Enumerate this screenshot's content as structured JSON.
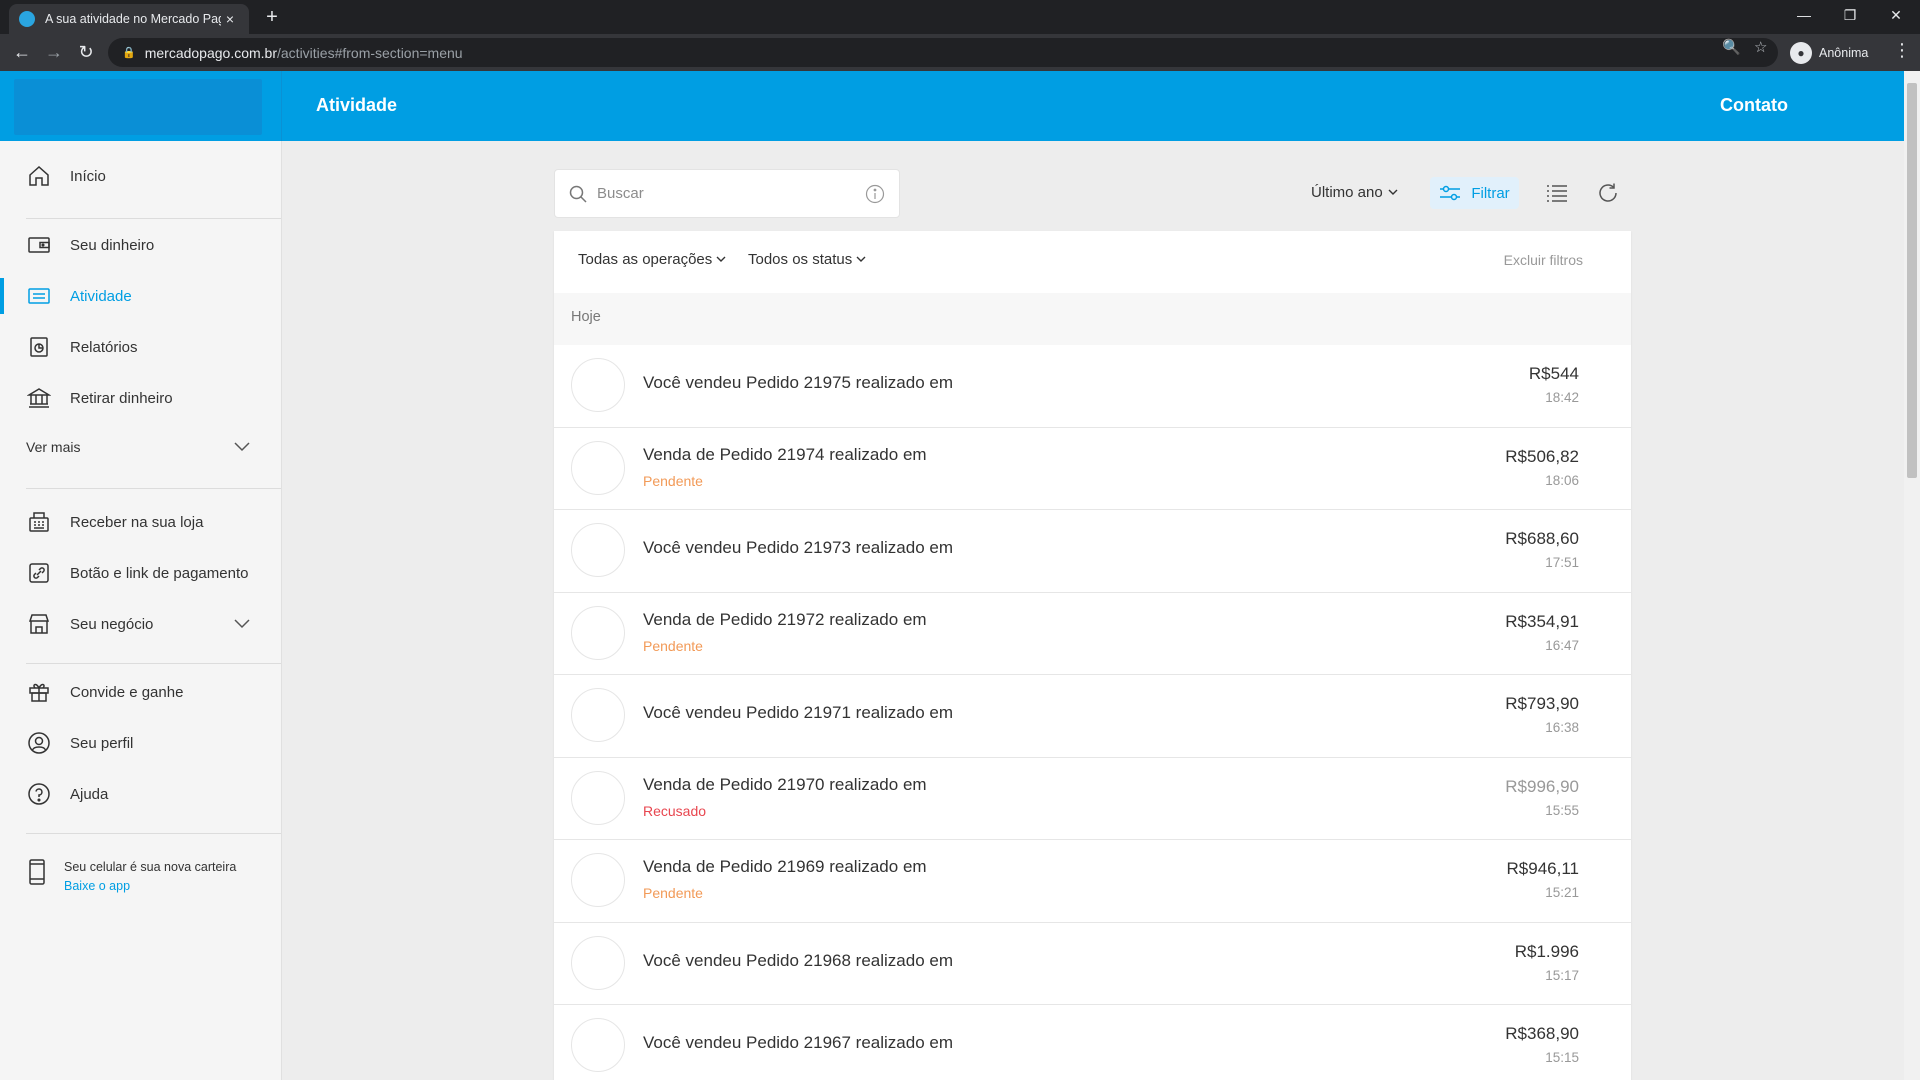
{
  "browser": {
    "tab_title": "A sua atividade no Mercado Pago",
    "tab_close": "×",
    "new_tab": "+",
    "url_host": "mercadopago.com.br",
    "url_path": "/activities#from-section=menu",
    "profile_label": "Anônima"
  },
  "header": {
    "title": "Atividade",
    "contact": "Contato"
  },
  "sidebar": {
    "items": [
      {
        "label": "Início"
      },
      {
        "label": "Seu dinheiro"
      },
      {
        "label": "Atividade"
      },
      {
        "label": "Relatórios"
      },
      {
        "label": "Retirar dinheiro"
      },
      {
        "label": "Ver mais"
      },
      {
        "label": "Receber na sua loja"
      },
      {
        "label": "Botão e link de pagamento"
      },
      {
        "label": "Seu negócio"
      },
      {
        "label": "Convide e ganhe"
      },
      {
        "label": "Seu perfil"
      },
      {
        "label": "Ajuda"
      }
    ],
    "app_text": "Seu celular é sua nova carteira",
    "app_link": "Baixe o app"
  },
  "toolbar": {
    "search_placeholder": "Buscar",
    "period": "Último ano",
    "filter_label": "Filtrar"
  },
  "filters": {
    "operations": "Todas as operações",
    "status": "Todos os status",
    "clear": "Excluir filtros"
  },
  "day_header": "Hoje",
  "status_colors": {
    "Pendente": "#f29a57",
    "Recusado": "#e8464f"
  },
  "transactions": [
    {
      "desc": "Você vendeu Pedido 21975 realizado em",
      "status": "",
      "amount": "R$544",
      "time": "18:42"
    },
    {
      "desc": "Venda de Pedido 21974 realizado em",
      "status": "Pendente",
      "amount": "R$506,82",
      "time": "18:06"
    },
    {
      "desc": "Você vendeu Pedido 21973 realizado em",
      "status": "",
      "amount": "R$688,60",
      "time": "17:51"
    },
    {
      "desc": "Venda de Pedido 21972 realizado em",
      "status": "Pendente",
      "amount": "R$354,91",
      "time": "16:47"
    },
    {
      "desc": "Você vendeu Pedido 21971 realizado em",
      "status": "",
      "amount": "R$793,90",
      "time": "16:38"
    },
    {
      "desc": "Venda de Pedido 21970 realizado em",
      "status": "Recusado",
      "amount": "R$996,90",
      "time": "15:55"
    },
    {
      "desc": "Venda de Pedido 21969 realizado em",
      "status": "Pendente",
      "amount": "R$946,11",
      "time": "15:21"
    },
    {
      "desc": "Você vendeu Pedido 21968 realizado em",
      "status": "",
      "amount": "R$1.996",
      "time": "15:17"
    },
    {
      "desc": "Você vendeu Pedido 21967 realizado em",
      "status": "",
      "amount": "R$368,90",
      "time": "15:15"
    }
  ]
}
